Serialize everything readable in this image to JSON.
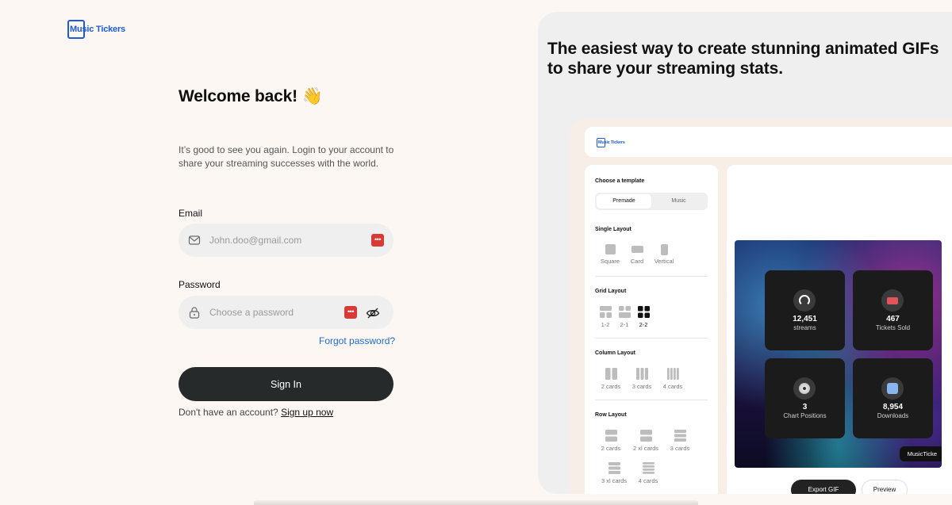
{
  "brand": {
    "name": "Music Tickers",
    "color": "#1e5bd8"
  },
  "login": {
    "title": "Welcome back! 👋",
    "subtitle": "It’s good to see you again. Login to your account to share your streaming successes with the world.",
    "email_label": "Email",
    "email_placeholder": "John.doo@gmail.com",
    "password_label": "Password",
    "password_placeholder": "Choose a password",
    "forgot": "Forgot password?",
    "sign_in": "Sign In",
    "no_account": "Don't have an account?",
    "sign_up": "Sign up now"
  },
  "promo": {
    "tagline": "The easiest way to create stunning animated GIFs to share your streaming stats.",
    "app": {
      "logo": "Music Tickers",
      "choose_template": "Choose a template",
      "tabs": [
        "Premade",
        "Music"
      ],
      "single_layout": {
        "title": "Single Layout",
        "options": [
          "Square",
          "Card",
          "Vertical"
        ]
      },
      "grid_layout": {
        "title": "Grid Layout",
        "options": [
          "1-2",
          "2-1",
          "2-2"
        ],
        "selected": "2-2"
      },
      "column_layout": {
        "title": "Column Layout",
        "options": [
          "2 cards",
          "3 cards",
          "4 cards"
        ]
      },
      "row_layout": {
        "title": "Row Layout",
        "options": [
          "2 cards",
          "2 xl cards",
          "3 cards",
          "3 xl cards",
          "4 cards"
        ]
      },
      "stats": [
        {
          "value": "12,451",
          "caption": "streams",
          "icon": "headphones-icon"
        },
        {
          "value": "467",
          "caption": "Tickets Sold",
          "icon": "ticket-icon"
        },
        {
          "value": "3",
          "caption": "Chart Positions",
          "icon": "disc-icon"
        },
        {
          "value": "8,954",
          "caption": "Downloads",
          "icon": "download-icon"
        }
      ],
      "watermark": "MusicTicke",
      "export_label": "Export GIF",
      "preview_label": "Preview"
    }
  }
}
